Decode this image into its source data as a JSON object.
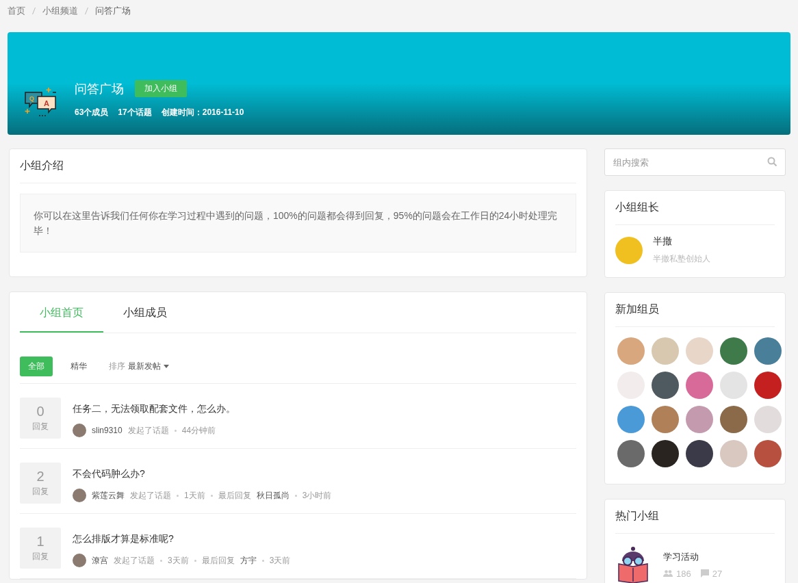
{
  "breadcrumb": [
    "首页",
    "小组频道",
    "问答广场"
  ],
  "group": {
    "icon_letters": [
      "Q",
      "A"
    ],
    "name": "问答广场",
    "join_button": "加入小组",
    "stats": [
      "63个成员",
      "17个话题",
      "创建时间：2016-11-10"
    ]
  },
  "intro": {
    "title": "小组介绍",
    "text": "你可以在这里告诉我们任何你在学习过程中遇到的问题，100%的问题都会得到回复，95%的问题会在工作日的24小时处理完毕！"
  },
  "tabs": [
    {
      "label": "小组首页",
      "selected": true
    },
    {
      "label": "小组成员",
      "selected": false
    }
  ],
  "filters": [
    {
      "label": "全部",
      "selected": true
    },
    {
      "label": "精华",
      "selected": false
    }
  ],
  "sort": {
    "label": "排序",
    "value": "最新发帖"
  },
  "posts": [
    {
      "count": "0",
      "count_label": "回复",
      "title": "任务二，无法领取配套文件，怎么办。",
      "author": "slin9310",
      "action": "发起了话题",
      "time": "44分钟前"
    },
    {
      "count": "2",
      "count_label": "回复",
      "title": "不会代码肿么办?",
      "author": "紫莲云舞",
      "action": "发起了话题",
      "time": "1天前",
      "reply_label": "最后回复",
      "replier": "秋日孤尚",
      "reply_time": "3小时前"
    },
    {
      "count": "1",
      "count_label": "回复",
      "title": "怎么排版才算是标准呢?",
      "author": "潦宫",
      "action": "发起了话题",
      "time": "3天前",
      "reply_label": "最后回复",
      "replier": "方宇",
      "reply_time": "3天前"
    }
  ],
  "search": {
    "placeholder": "组内搜索"
  },
  "leader": {
    "title": "小组组长",
    "name": "半撤",
    "role": "半撤私塾创始人"
  },
  "new_members": {
    "title": "新加组员",
    "members": [
      {
        "color": "#d9a77e"
      },
      {
        "color": "#d8c8b0"
      },
      {
        "color": "#e8d6c8"
      },
      {
        "color": "#3f7a4a"
      },
      {
        "color": "#4a7f9a"
      },
      {
        "color": "#f2ecec"
      },
      {
        "color": "#4f5a60"
      },
      {
        "color": "#d86a9a"
      },
      {
        "color": "#e4e4e4"
      },
      {
        "color": "#c42020"
      },
      {
        "color": "#4a9ad8"
      },
      {
        "color": "#b08058"
      },
      {
        "color": "#c49aae"
      },
      {
        "color": "#8a6a48"
      },
      {
        "color": "#e2dcdc"
      },
      {
        "color": "#6a6a6a"
      },
      {
        "color": "#2a2420"
      },
      {
        "color": "#3a3a48"
      },
      {
        "color": "#d8c8c0"
      },
      {
        "color": "#b85040"
      }
    ]
  },
  "hot_groups": {
    "title": "热门小组",
    "items": [
      {
        "name": "学习活动",
        "members": "186",
        "topics": "27"
      }
    ]
  }
}
